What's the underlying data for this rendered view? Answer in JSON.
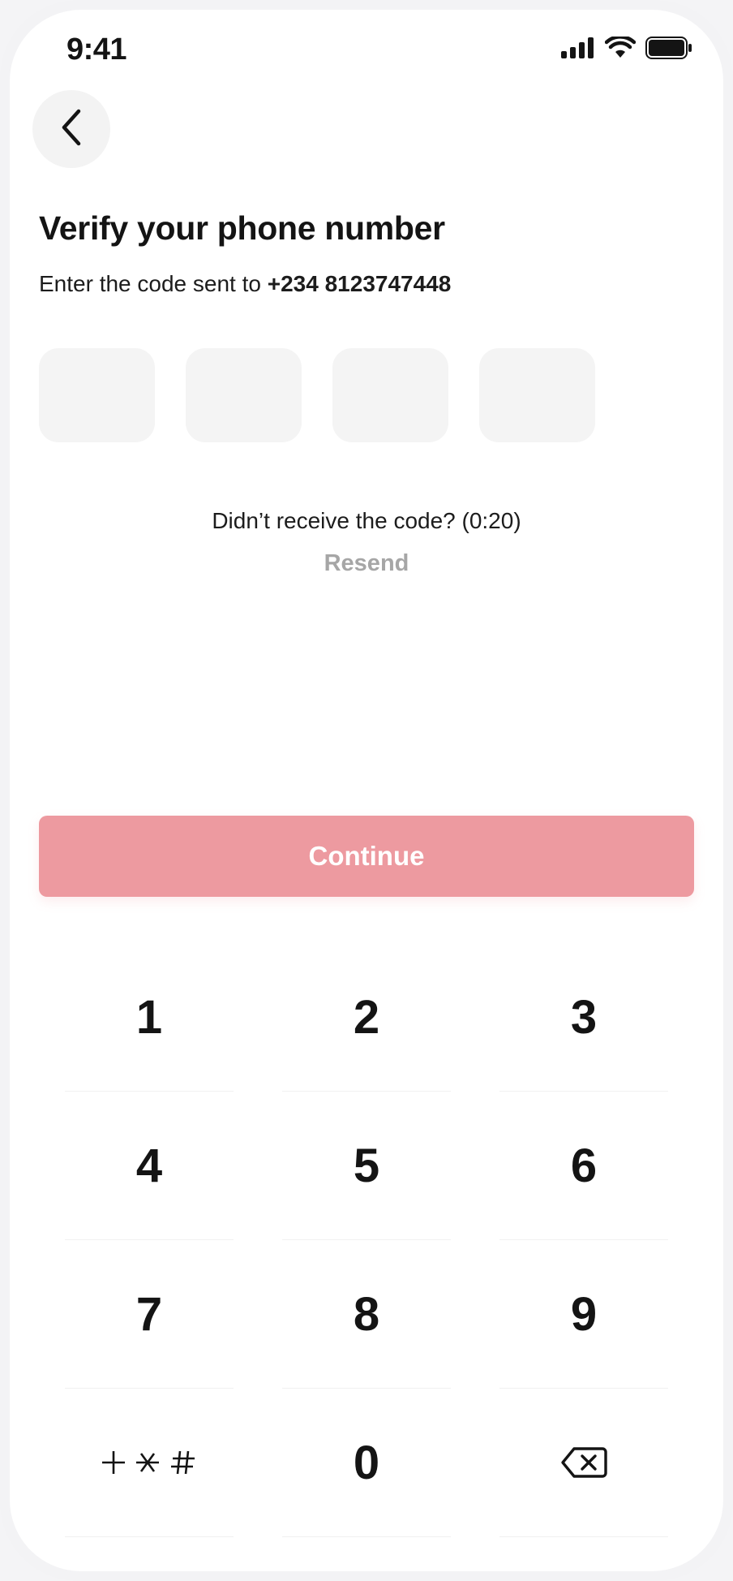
{
  "status_bar": {
    "time": "9:41"
  },
  "header": {
    "title": "Verify your phone number",
    "subtitle_prefix": "Enter the code sent to ",
    "phone_number": "+234 8123747448"
  },
  "otp": {
    "digits": [
      "",
      "",
      "",
      ""
    ]
  },
  "resend": {
    "prompt": "Didn’t receive the code? (0:20)",
    "link_label": "Resend"
  },
  "actions": {
    "continue_label": "Continue"
  },
  "keypad": {
    "keys": [
      "1",
      "2",
      "3",
      "4",
      "5",
      "6",
      "7",
      "8",
      "9",
      "+ * #",
      "0",
      "backspace-icon"
    ]
  },
  "colors": {
    "accent_disabled": "#ed9aa0",
    "muted": "#a6a6a6",
    "field_bg": "#f4f4f4"
  }
}
